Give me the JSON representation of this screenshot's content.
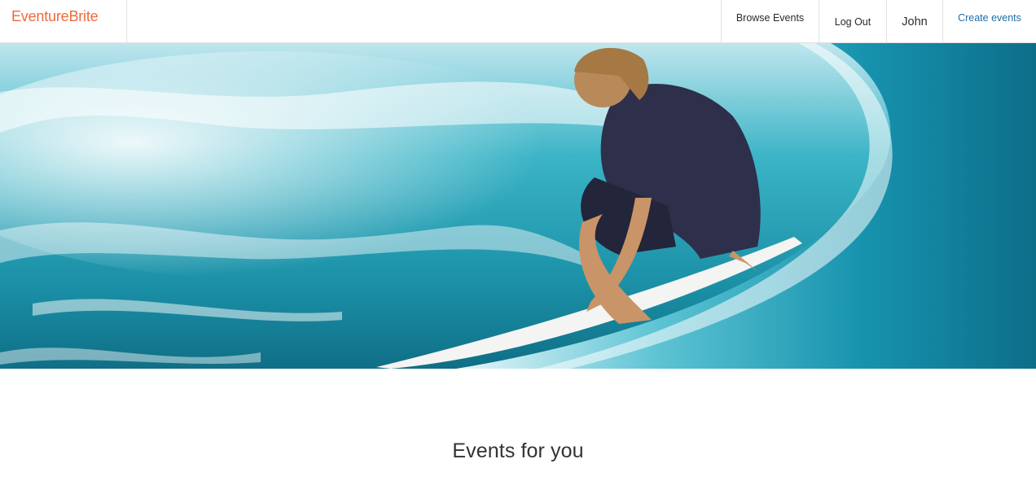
{
  "header": {
    "logo": "EventureBrite",
    "nav": {
      "browse": "Browse Events",
      "logout": "Log Out",
      "user": "John",
      "create": "Create events"
    }
  },
  "hero": {
    "image": "surfer riding a breaking wave"
  },
  "main": {
    "section_title": "Events for you"
  },
  "colors": {
    "brand": "#ef6a3c",
    "link": "#1f6ea8"
  }
}
